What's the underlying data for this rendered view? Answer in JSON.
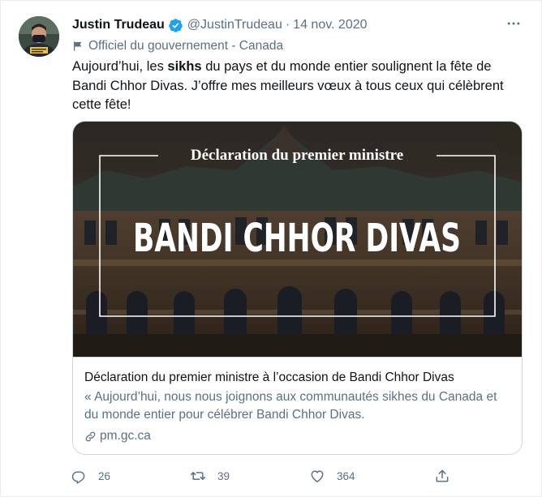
{
  "tweet": {
    "author_name": "Justin Trudeau",
    "handle": "@JustinTrudeau",
    "separator": "·",
    "date": "14 nov. 2020",
    "more_icon": "more-horizontal-icon",
    "verified_icon": "verified-badge-icon",
    "gov_label": "Officiel du gouvernement - Canada",
    "gov_icon": "flag-icon",
    "text_before": "Aujourd’hui, les ",
    "text_bold": "sikhs",
    "text_after": " du pays et du monde entier soulignent la fête de Bandi Chhor Divas. J’offre mes meilleurs vœux à tous ceux qui célèbrent cette fête!"
  },
  "card": {
    "image_heading": "Déclaration du premier ministre",
    "image_title": "BANDI CHHOR DIVAS",
    "title": "Déclaration du premier ministre à l’occasion de Bandi Chhor Divas",
    "description": "« Aujourd’hui, nous nous joignons aux communautés sikhes du Canada et du monde entier pour célébrer Bandi Chhor Divas.",
    "domain": "pm.gc.ca",
    "link_icon": "link-icon"
  },
  "actions": {
    "reply_count": "26",
    "retweet_count": "39",
    "like_count": "364",
    "reply_icon": "reply-icon",
    "retweet_icon": "retweet-icon",
    "like_icon": "heart-icon",
    "share_icon": "share-icon"
  },
  "colors": {
    "text_primary": "#0f1419",
    "text_secondary": "#5b7083",
    "verified_blue": "#1da1f2",
    "border": "#cfd9de"
  }
}
